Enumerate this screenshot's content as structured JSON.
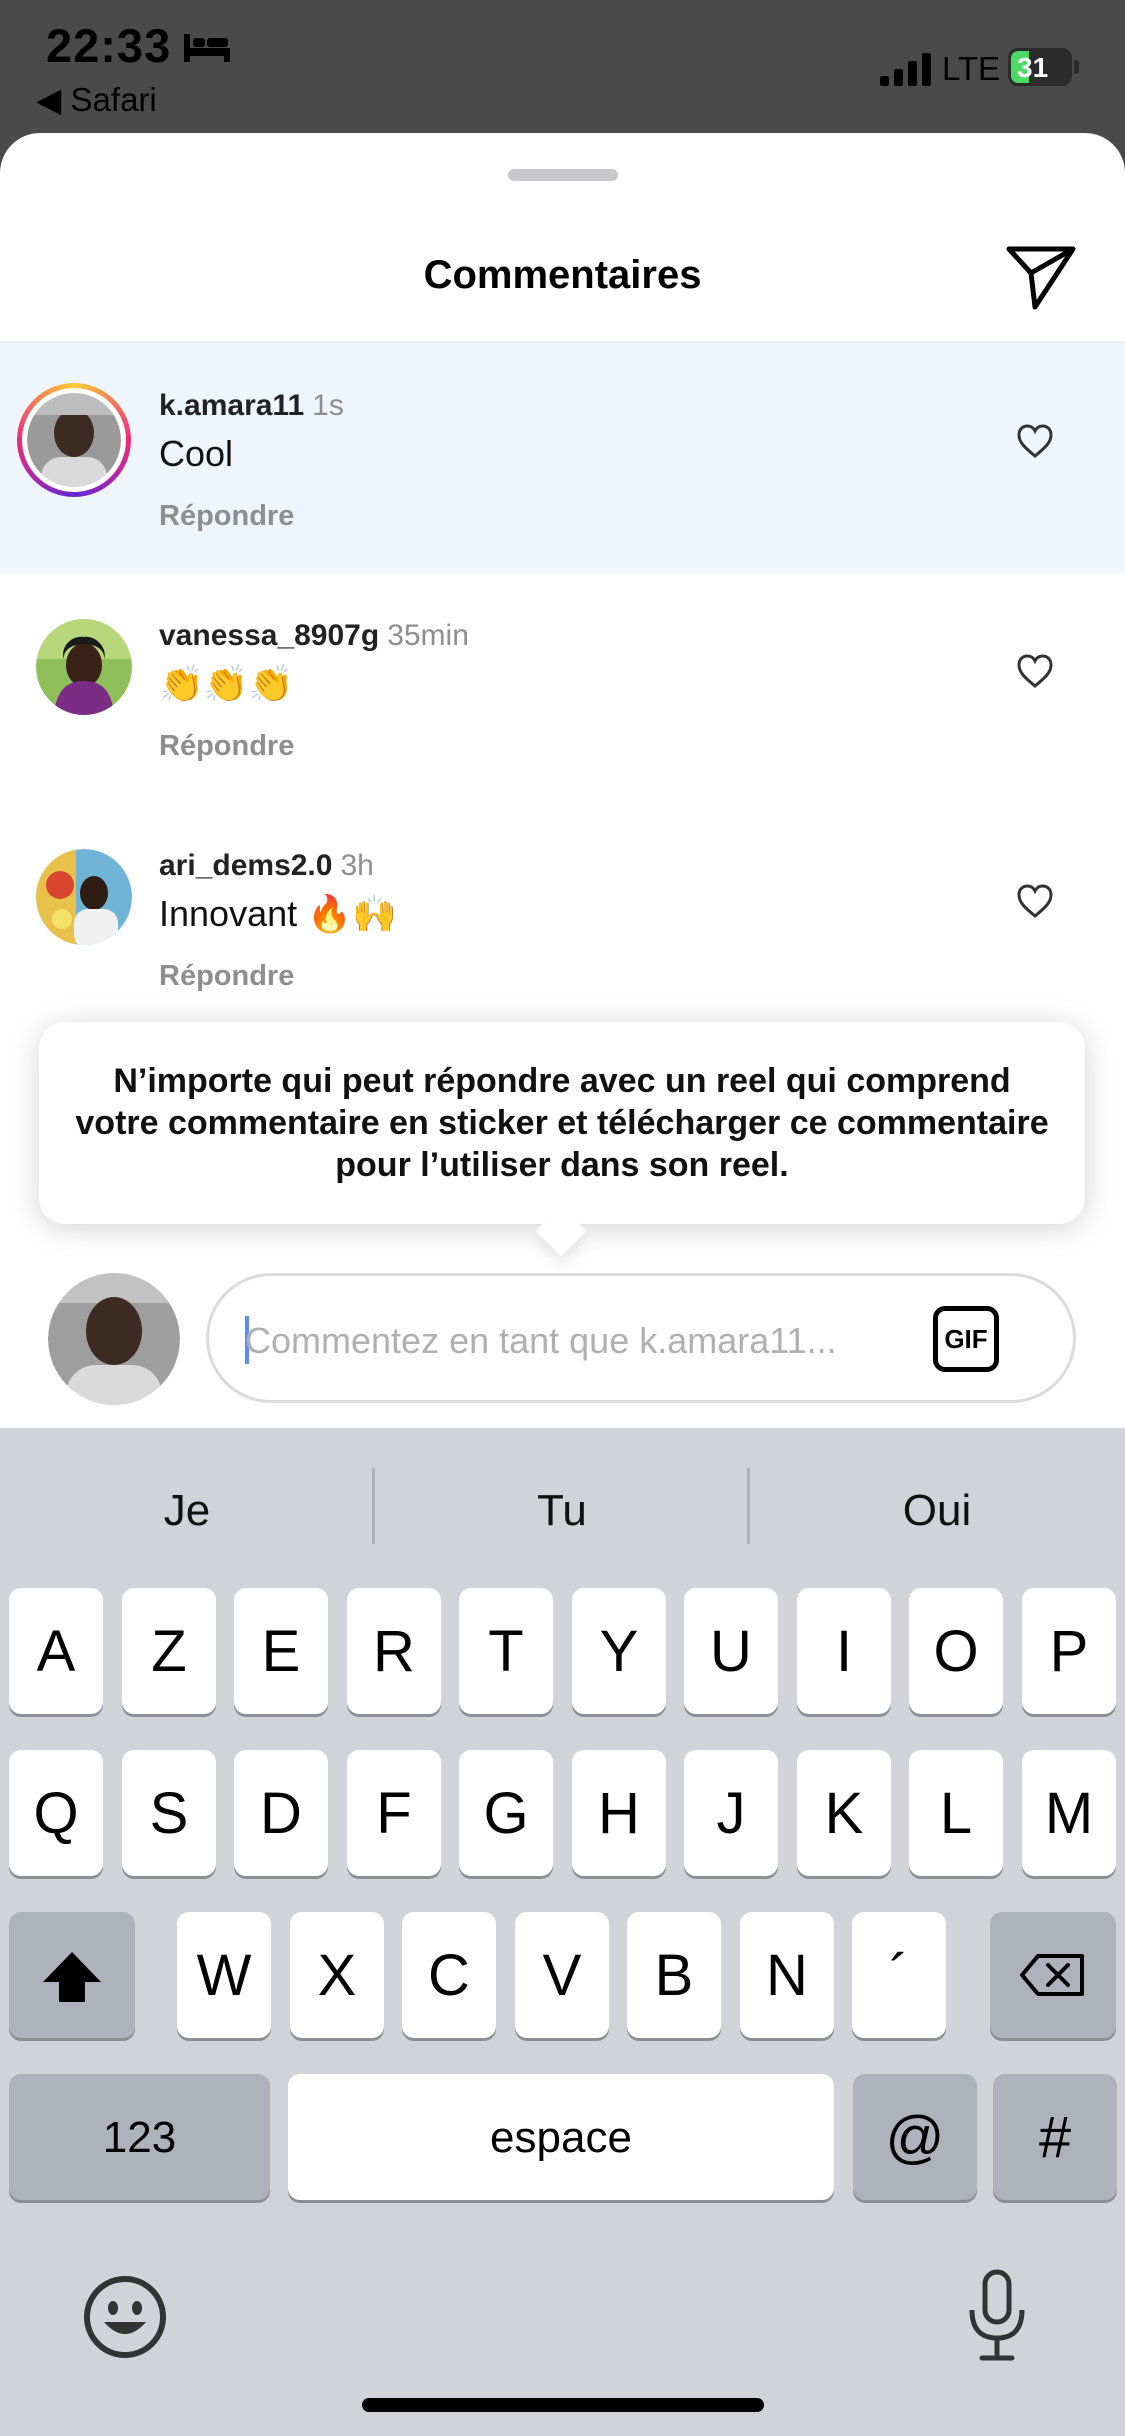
{
  "status_bar": {
    "time": "22:33",
    "back_label": "◀ Safari",
    "network": "LTE",
    "battery": "31",
    "battery_level": 0.31
  },
  "sheet": {
    "title": "Commentaires"
  },
  "comments": [
    {
      "username": "k.amara11",
      "time": "1s",
      "text": "Cool",
      "reply": "Répondre"
    },
    {
      "username": "vanessa_8907g",
      "time": "35min",
      "text": "👏👏👏",
      "reply": "Répondre"
    },
    {
      "username": "ari_dems2.0",
      "time": "3h",
      "text": "Innovant 🔥🙌",
      "reply": "Répondre"
    }
  ],
  "tooltip": {
    "text": "N’importe qui peut répondre avec un reel qui comprend votre commentaire en sticker et télécharger ce commentaire pour l’utiliser dans son reel."
  },
  "composer": {
    "placeholder": "Commentez en tant que k.amara11...",
    "gif_label": "GIF"
  },
  "keyboard": {
    "suggestions": [
      "Je",
      "Tu",
      "Oui"
    ],
    "row1": [
      "A",
      "Z",
      "E",
      "R",
      "T",
      "Y",
      "U",
      "I",
      "O",
      "P"
    ],
    "row2": [
      "Q",
      "S",
      "D",
      "F",
      "G",
      "H",
      "J",
      "K",
      "L",
      "M"
    ],
    "row3": [
      "W",
      "X",
      "C",
      "V",
      "B",
      "N",
      "´"
    ],
    "numbers_label": "123",
    "space_label": "espace",
    "at_label": "@",
    "hash_label": "#"
  },
  "colors": {
    "accent": "#5a8dee",
    "highlight": "#eff5fd",
    "battery": "#4cd964"
  }
}
